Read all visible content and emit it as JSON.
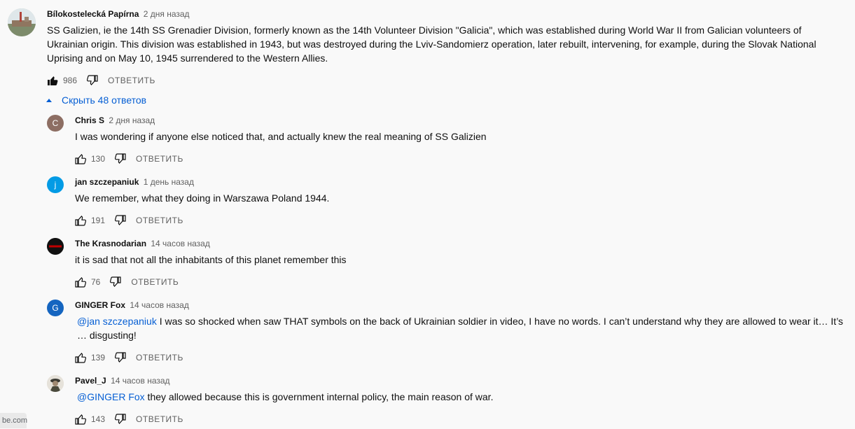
{
  "comment_main": {
    "author": "Bílokostelecká Papírna",
    "time": "2 дня назад",
    "text": "SS Galizien, ie the 14th SS Grenadier Division, formerly known as the 14th Volunteer Division \"Galicia\", which was established during World War II from Galician volunteers of Ukrainian origin. This division was established in 1943, but was destroyed during the Lviv-Sandomierz operation, later rebuilt, intervening, for example, during the Slovak National Uprising and on May 10, 1945 surrendered to the Western Allies.",
    "likes": "986",
    "reply_label": "ОТВЕТИТЬ"
  },
  "replies_toggle": {
    "label": "Скрыть 48 ответов"
  },
  "replies": [
    {
      "author": "Chris S",
      "time": "2 дня назад",
      "avatar_letter": "C",
      "avatar_color": "#8d6e63",
      "text": "I was wondering if anyone else noticed that, and actually knew the real meaning of SS Galizien",
      "likes": "130",
      "reply_label": "ОТВЕТИТЬ"
    },
    {
      "author": "jan szczepaniuk",
      "time": "1 день назад",
      "avatar_letter": "j",
      "avatar_color": "#039be5",
      "text": "We remember, what they doing in Warszawa Poland 1944.",
      "likes": "191",
      "reply_label": "ОТВЕТИТЬ"
    },
    {
      "author": "The Krasnodarian",
      "time": "14 часов назад",
      "avatar_color": "#c00000",
      "text": "it is sad that not all the inhabitants of this planet remember this",
      "likes": "76",
      "reply_label": "ОТВЕТИТЬ"
    },
    {
      "author": "GINGER Fox",
      "time": "14 часов назад",
      "avatar_letter": "G",
      "avatar_color": "#1565c0",
      "mention": "@jan szczepaniuk",
      "text": " I was so shocked when saw THAT symbols on the back of Ukrainian soldier in video, I have no words. I can’t understand why they are allowed to wear it… It’s … disgusting!",
      "likes": "139",
      "reply_label": "ОТВЕТИТЬ"
    },
    {
      "author": "Pavel_J",
      "time": "14 часов назад",
      "mention": "@GINGER Fox",
      "text": " they allowed because this is government internal policy, the main reason of war.",
      "likes": "143",
      "reply_label": "ОТВЕТИТЬ"
    }
  ],
  "url_fragment": "be.com",
  "colors": {
    "link": "#065fd4",
    "secondary_text": "#606060"
  }
}
